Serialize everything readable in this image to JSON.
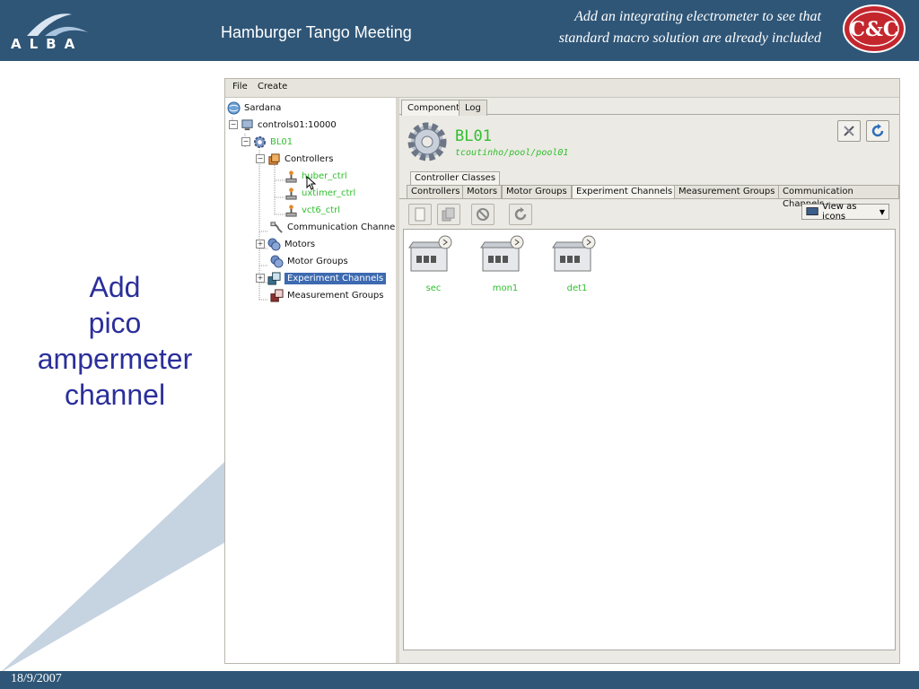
{
  "slide": {
    "logo_text": "ALBA",
    "title": "Hamburger Tango Meeting",
    "note_line1": "Add an integrating electrometer to see that",
    "note_line2": "standard macro solution are already included",
    "cc_logo_text": "C&C",
    "date": "18/9/2007",
    "callout_lines": [
      "Add",
      "pico",
      "ampermeter",
      "channel"
    ],
    "colors": {
      "header": "#2f5677",
      "callout_text": "#2b2f9a",
      "green_text": "#2fbf2f",
      "selection": "#3d6ab0"
    }
  },
  "app": {
    "menu": [
      "File",
      "Create"
    ],
    "tree": [
      {
        "label": "Sardana",
        "icon": "globe-icon",
        "green": false
      },
      {
        "label": "controls01:10000",
        "icon": "computer-icon",
        "green": false
      },
      {
        "label": "BL01",
        "icon": "gear-icon",
        "green": true
      },
      {
        "label": "Controllers",
        "icon": "controllers-icon",
        "green": false
      },
      {
        "label": "huber_ctrl",
        "icon": "joystick-icon",
        "green": true
      },
      {
        "label": "uxtimer_ctrl",
        "icon": "joystick-icon",
        "green": true
      },
      {
        "label": "vct6_ctrl",
        "icon": "joystick-icon",
        "green": true
      },
      {
        "label": "Communication Channels",
        "icon": "cable-icon",
        "green": false
      },
      {
        "label": "Motors",
        "icon": "motors-icon",
        "green": false
      },
      {
        "label": "Motor Groups",
        "icon": "motor-groups-icon",
        "green": false
      },
      {
        "label": "Experiment Channels",
        "icon": "experiment-channels-icon",
        "green": false,
        "selected": true
      },
      {
        "label": "Measurement Groups",
        "icon": "measurement-groups-icon",
        "green": false
      }
    ],
    "top_tabs": [
      "Component",
      "Log"
    ],
    "component": {
      "name": "BL01",
      "path": "tcoutinho/pool/pool01"
    },
    "class_tab": "Controller Classes",
    "sub_tabs": [
      "Controllers",
      "Motors",
      "Motor Groups",
      "Experiment Channels",
      "Measurement Groups",
      "Communication Channels"
    ],
    "active_sub_tab": "Experiment Channels",
    "view_mode": "View as icons",
    "channels": [
      "sec",
      "mon1",
      "det1"
    ]
  }
}
